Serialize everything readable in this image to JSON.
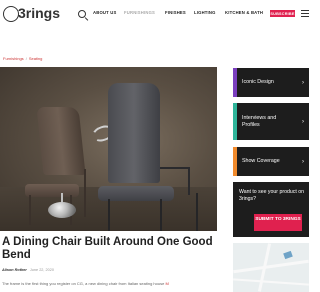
{
  "header": {
    "logo_text": "3rings",
    "nav": [
      "ABOUT US",
      "FURNISHINGS",
      "FINISHES",
      "LIGHTING",
      "KITCHEN & BATH"
    ],
    "subscribe_label": "SUBSCRIBE"
  },
  "breadcrumb": [
    "Furnishings",
    "Seating"
  ],
  "article": {
    "title": "A Dining Chair Built Around One Good Bend",
    "author": "Alison Rother",
    "date": "June 22, 2020",
    "intro_text": "The frame is the first thing you register on CG, a new dining chair from Italian seating house",
    "intro_link": "M"
  },
  "sidebar": {
    "cards": [
      {
        "label": "Iconic Design",
        "accent": "#7b3fbf"
      },
      {
        "label": "Interviews and Profiles",
        "accent": "#2fb59a"
      },
      {
        "label": "Show Coverage",
        "accent": "#f08a2c"
      }
    ],
    "promo_text": "Want to see your product on 3rings?",
    "promo_button": "SUBMIT TO 3RINGS"
  },
  "colors": {
    "accent_red": "#e0214f",
    "card_bg": "#1d1d1d"
  }
}
